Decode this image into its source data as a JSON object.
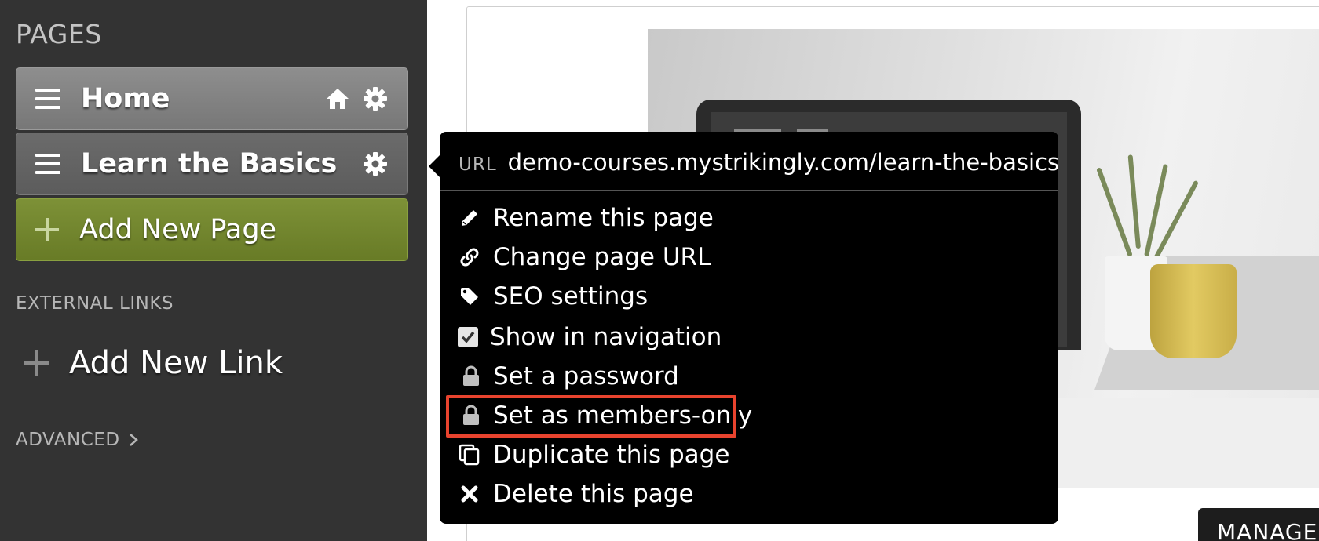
{
  "sidebar": {
    "pages_title": "PAGES",
    "pages": [
      {
        "label": "Home",
        "icons": [
          "home-icon",
          "gear-icon"
        ]
      },
      {
        "label": "Learn the Basics",
        "icons": [
          "gear-icon"
        ]
      }
    ],
    "add_page_label": "Add New Page",
    "external_links_title": "EXTERNAL LINKS",
    "add_link_label": "Add New Link",
    "advanced_label": "ADVANCED"
  },
  "popover": {
    "url_label": "URL",
    "url_value": "demo-courses.mystrikingly.com/learn-the-basics",
    "items": [
      {
        "label": "Rename this page",
        "icon": "pencil-icon"
      },
      {
        "label": "Change page URL",
        "icon": "link-icon"
      },
      {
        "label": "SEO settings",
        "icon": "tag-icon"
      },
      {
        "label": "Show in navigation",
        "icon": "checkbox-icon",
        "checked": true
      },
      {
        "label": "Set a password",
        "icon": "lock-icon"
      },
      {
        "label": "Set as members-only",
        "icon": "lock-icon",
        "highlighted": true
      },
      {
        "label": "Duplicate this page",
        "icon": "copy-icon"
      },
      {
        "label": "Delete this page",
        "icon": "close-icon"
      }
    ]
  },
  "main": {
    "manage_button_label": "MANAGE"
  },
  "colors": {
    "sidebar_bg": "#333333",
    "add_page_green": "#75892f",
    "highlight_red": "#e8432e",
    "popover_bg": "#000000"
  }
}
